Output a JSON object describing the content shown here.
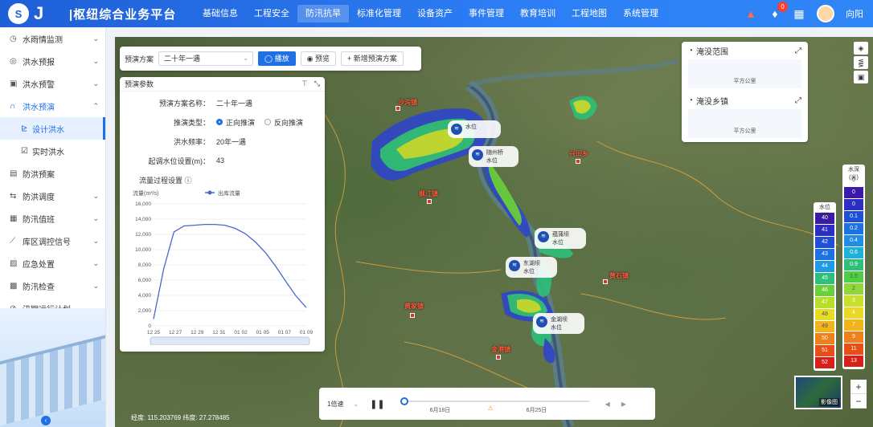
{
  "header": {
    "logo_mark": "S",
    "title": "|枢纽综合业务平台",
    "nav": [
      "基础信息",
      "工程安全",
      "防汛抗旱",
      "标准化管理",
      "设备资产",
      "事件管理",
      "教育培训",
      "工程地图",
      "系统管理"
    ],
    "active_nav": 2,
    "notification_count": "0",
    "user_name": "向阳"
  },
  "sidebar": {
    "items": [
      {
        "label": "水雨情监测",
        "icon": "◷",
        "arrow": "⌄"
      },
      {
        "label": "洪水预报",
        "icon": "◎",
        "arrow": "⌄"
      },
      {
        "label": "洪水预警",
        "icon": "▣",
        "arrow": "⌄"
      },
      {
        "label": "洪水预演",
        "icon": "∩",
        "arrow": "⌃"
      }
    ],
    "sub_items": [
      {
        "label": "设计洪水",
        "icon": "⊵"
      },
      {
        "label": "实时洪水",
        "icon": "☑"
      }
    ],
    "more_items": [
      {
        "label": "防洪预案",
        "icon": "▤",
        "arrow": ""
      },
      {
        "label": "防洪调度",
        "icon": "⇆",
        "arrow": "⌄"
      },
      {
        "label": "防汛值班",
        "icon": "▦",
        "arrow": "⌄"
      },
      {
        "label": "库区调控信号",
        "icon": "⟋",
        "arrow": "⌄"
      },
      {
        "label": "应急处置",
        "icon": "▨",
        "arrow": "⌄"
      },
      {
        "label": "防汛检查",
        "icon": "▩",
        "arrow": "⌄"
      },
      {
        "label": "汛期运行计划",
        "icon": "⊘",
        "arrow": ""
      }
    ]
  },
  "plan_bar": {
    "label": "预演方案",
    "selected": "二十年一遇",
    "play_label": "播放",
    "preview_label": "预览",
    "add_label": "新增预演方案"
  },
  "params": {
    "title": "预演参数",
    "plan_name_key": "预演方案名称：",
    "plan_name_val": "二十年一遇",
    "type_key": "推演类型：",
    "type_forward": "正向推演",
    "type_backward": "反向推演",
    "freq_key": "洪水频率：",
    "freq_val": "20年一遇",
    "level_key": "起调水位设置(m)：",
    "level_val": "43",
    "flow_title": "流量过程设置"
  },
  "chart_data": {
    "type": "line",
    "ylabel": "流量(m³/s)",
    "legend": "出库流量",
    "ylim": [
      0,
      16000
    ],
    "yticks": [
      "16,000",
      "14,000",
      "12,000",
      "10,000",
      "8,000",
      "6,000",
      "4,000",
      "2,000",
      "0"
    ],
    "xticks": [
      "12 25",
      "12 27",
      "12 29",
      "12 31",
      "01 02",
      "01 05",
      "01 07",
      "01 09"
    ],
    "x_last_label": "01 09",
    "series": [
      {
        "name": "出库流量",
        "values": [
          900,
          7500,
          12300,
          13100,
          13200,
          13300,
          13300,
          13200,
          12800,
          12100,
          11000,
          9600,
          7800,
          5800,
          3900,
          2400
        ]
      }
    ]
  },
  "stats": [
    {
      "title": "淹没范围",
      "unit": "平方公里"
    },
    {
      "title": "淹没乡镇",
      "unit": "平方公里"
    }
  ],
  "legend_level": {
    "title": "水位(米)",
    "values": [
      "40",
      "41",
      "42",
      "43",
      "44",
      "45",
      "46",
      "47",
      "48",
      "49",
      "50",
      "51",
      "52"
    ],
    "colors": [
      "#3a1aa8",
      "#2b2fc2",
      "#1f4fd6",
      "#1c72e0",
      "#1e9be6",
      "#2ec07a",
      "#6ad03a",
      "#b9dd2c",
      "#e7dd22",
      "#f1b31e",
      "#f0801a",
      "#e84e18",
      "#d82018"
    ]
  },
  "legend_depth": {
    "title": "水深(米)",
    "values": [
      "0",
      "0",
      "0",
      "0.1",
      "0.2",
      "0.4",
      "0.6",
      "0.9",
      "1.5",
      "2",
      "3",
      "4",
      "7",
      "9",
      "11",
      "13"
    ],
    "colors": [
      "#ffffff",
      "#3a1aa8",
      "#2b2fc2",
      "#1f4fd6",
      "#1c72e0",
      "#1e8ee6",
      "#1eb0d8",
      "#2ec07a",
      "#4fcd45",
      "#8fd83a",
      "#c6e02c",
      "#ebd822",
      "#f1b31e",
      "#f0801a",
      "#e84e18",
      "#d82018"
    ]
  },
  "gauges": [
    {
      "name": "水位"
    },
    {
      "name": "随州桥",
      "sub": "水位"
    },
    {
      "name": "蕴蒲坝",
      "sub": "水位"
    },
    {
      "name": "东湖坝",
      "sub": "水位"
    },
    {
      "name": "金湖坝",
      "sub": "水位"
    }
  ],
  "towns": [
    "沙沟镇",
    "兴田乡",
    "枫江镇",
    "黄家镇",
    "黄石镇",
    "金港镇"
  ],
  "timeline": {
    "speed": "1倍速",
    "date1": "6月18日",
    "date2": "6月25日"
  },
  "coords": "经度: 115.203769 纬度: 27.278485",
  "basemap_label": "影像图"
}
